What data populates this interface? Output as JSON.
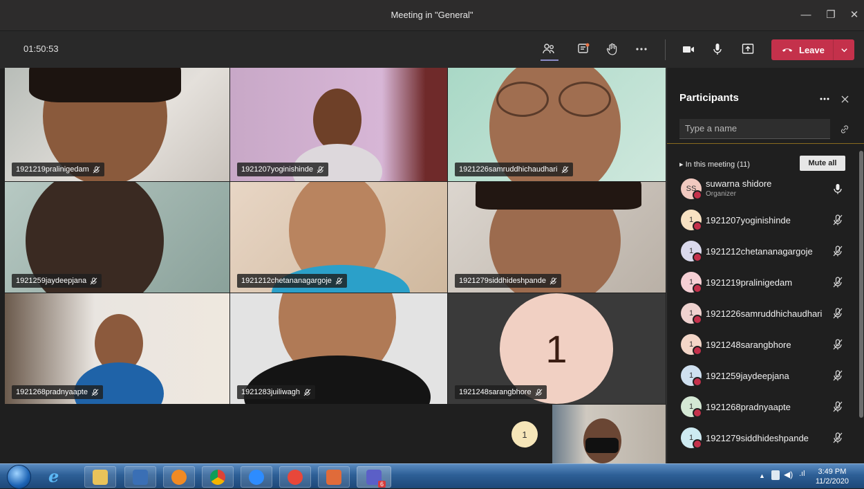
{
  "window": {
    "title": "Meeting in \"General\"",
    "controls": [
      "—",
      "❐",
      "✕"
    ]
  },
  "toolbar": {
    "timer": "01:50:53",
    "leave_label": "Leave",
    "icons": [
      "participants-icon",
      "chat-icon",
      "raise-hand-icon",
      "more-actions-icon",
      "camera-icon",
      "mic-icon",
      "share-icon"
    ]
  },
  "videos": [
    {
      "name": "1921219pralinigedam",
      "mic": "off"
    },
    {
      "name": "1921207yoginishinde",
      "mic": "off"
    },
    {
      "name": "1921226samruddhichaudhari",
      "mic": "off"
    },
    {
      "name": "1921259jaydeepjana",
      "mic": "off"
    },
    {
      "name": "1921212chetananagargoje",
      "mic": "off"
    },
    {
      "name": "1921279siddhideshpande",
      "mic": "off"
    },
    {
      "name": "1921268pradnyaapte",
      "mic": "off"
    },
    {
      "name": "1921283juiliwagh",
      "mic": "off"
    },
    {
      "name": "1921248sarangbhore",
      "mic": "off",
      "avatar": "1"
    }
  ],
  "overflow_badge": "1",
  "participants_panel": {
    "title": "Participants",
    "search_placeholder": "Type a name",
    "section_label": "In this meeting (11)",
    "mute_all_label": "Mute all",
    "list": [
      {
        "initials": "SS",
        "name": "suwarna shidore",
        "role": "Organizer",
        "mic": "on",
        "avatar_color": "#f1c9c0"
      },
      {
        "initials": "1",
        "name": "1921207yoginishinde",
        "mic": "off",
        "avatar_color": "#f7e1c2"
      },
      {
        "initials": "1",
        "name": "1921212chetananagargoje",
        "mic": "off",
        "avatar_color": "#dad9ec"
      },
      {
        "initials": "1",
        "name": "1921219pralinigedam",
        "mic": "off",
        "avatar_color": "#f6cfd4"
      },
      {
        "initials": "1",
        "name": "1921226samruddhichaudhari",
        "mic": "off",
        "avatar_color": "#efd2cf"
      },
      {
        "initials": "1",
        "name": "1921248sarangbhore",
        "mic": "off",
        "avatar_color": "#f3d6c8"
      },
      {
        "initials": "1",
        "name": "1921259jaydeepjana",
        "mic": "off",
        "avatar_color": "#cfe0ef"
      },
      {
        "initials": "1",
        "name": "1921268pradnyaapte",
        "mic": "off",
        "avatar_color": "#d4e8d4"
      },
      {
        "initials": "1",
        "name": "1921279siddhideshpande",
        "mic": "off",
        "avatar_color": "#cdeaf1"
      }
    ]
  },
  "taskbar": {
    "time": "3:49 PM",
    "date": "11/2/2020",
    "teams_badge": "6"
  }
}
